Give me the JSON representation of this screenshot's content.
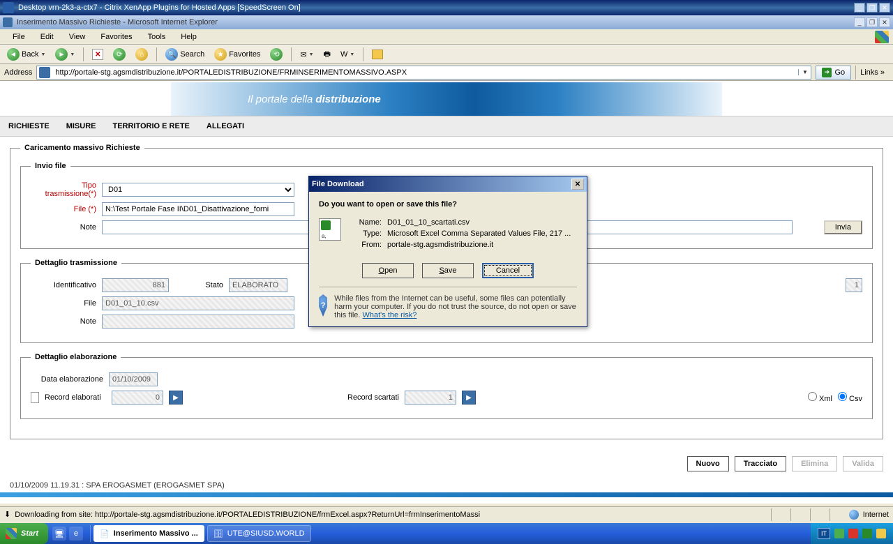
{
  "outer_title": "Desktop vrn-2k3-a-ctx7 - Citrix XenApp Plugins for Hosted Apps [SpeedScreen On]",
  "inner_title": "Inserimento Massivo Richieste - Microsoft Internet Explorer",
  "menu": {
    "file": "File",
    "edit": "Edit",
    "view": "View",
    "favorites": "Favorites",
    "tools": "Tools",
    "help": "Help"
  },
  "toolbar": {
    "back": "Back",
    "search": "Search",
    "favorites": "Favorites"
  },
  "address": {
    "label": "Address",
    "url": "http://portale-stg.agsmdistribuzione.it/PORTALEDISTRIBUZIONE/FRMINSERIMENTOMASSIVO.ASPX",
    "go": "Go",
    "links": "Links"
  },
  "banner": {
    "prefix": "Il portale della ",
    "bold": "distribuzione"
  },
  "tabs": {
    "t1": "RICHIESTE",
    "t2": "MISURE",
    "t3": "TERRITORIO E RETE",
    "t4": "ALLEGATI"
  },
  "page": {
    "legend_main": "Caricamento massivo Richieste",
    "legend_invio": "Invio file",
    "tipo_label": "Tipo trasmissione(*)",
    "tipo_value": "D01",
    "file_label": "File (*)",
    "file_value": "N:\\Test Portale Fase II\\D01_Disattivazione_forni",
    "note_label": "Note",
    "note_value": "",
    "invia": "Invia",
    "legend_det_tx": "Dettaglio trasmissione",
    "id_label": "Identificativo",
    "id_value": "881",
    "stato_label": "Stato",
    "stato_value": "ELABORATO",
    "det_file_label": "File",
    "det_file_value": "D01_01_10.csv",
    "det_note_label": "Note",
    "det_note_value": "",
    "legend_elab": "Dettaglio elaborazione",
    "data_elab_label": "Data elaborazione",
    "data_elab_value": "01/10/2009",
    "rec_elab_label": "Record elaborati",
    "rec_elab_value": "0",
    "rec_scart_label": "Record scartati",
    "rec_scart_value": "1",
    "unknown_value": "1",
    "fmt_xml": "Xml",
    "fmt_csv": "Csv"
  },
  "footer_btns": {
    "nuovo": "Nuovo",
    "tracciato": "Tracciato",
    "elimina": "Elimina",
    "valida": "Valida"
  },
  "status_line": "01/10/2009 11.19.31   :   SPA EROGASMET   (EROGASMET SPA)",
  "ie_status": {
    "left": "Downloading from site: http://portale-stg.agsmdistribuzione.it/PORTALEDISTRIBUZIONE/frmExcel.aspx?ReturnUrl=frmInserimentoMassi",
    "zone": "Internet"
  },
  "taskbar": {
    "start": "Start",
    "task1": "Inserimento Massivo ...",
    "task2": "UTE@SIUSD.WORLD",
    "lang": "IT"
  },
  "dialog": {
    "title": "File Download",
    "question": "Do you want to open or save this file?",
    "name_k": "Name:",
    "name_v": "D01_01_10_scartati.csv",
    "type_k": "Type:",
    "type_v": "Microsoft Excel Comma Separated Values File, 217 ...",
    "from_k": "From:",
    "from_v": "portale-stg.agsmdistribuzione.it",
    "open": "Open",
    "save": "Save",
    "cancel": "Cancel",
    "warn": "While files from the Internet can be useful, some files can potentially harm your computer. If you do not trust the source, do not open or save this file. ",
    "risk": "What's the risk?"
  }
}
